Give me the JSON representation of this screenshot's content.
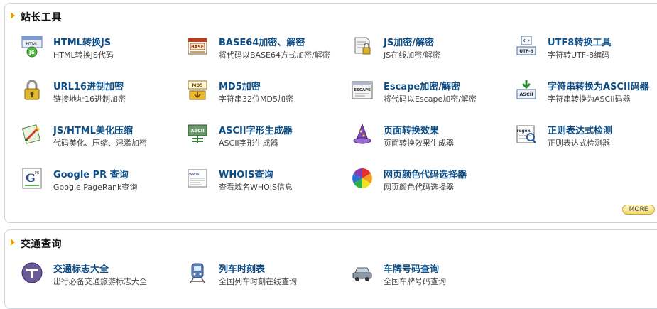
{
  "tools": {
    "header": "站长工具",
    "more_label": "MORE",
    "items": [
      {
        "title": "HTML转换JS",
        "desc": "HTML转换JS代码",
        "icon": "html-js-icon"
      },
      {
        "title": "BASE64加密、解密",
        "desc": "将代码以BASE64方式加密/解密",
        "icon": "base64-icon"
      },
      {
        "title": "JS加密/解密",
        "desc": "JS在线加密/解密",
        "icon": "js-encrypt-icon"
      },
      {
        "title": "UTF8转换工具",
        "desc": "字符转UTF-8编码",
        "icon": "utf8-icon"
      },
      {
        "title": "URL16进制加密",
        "desc": "链接地址16进制加密",
        "icon": "padlock-icon"
      },
      {
        "title": "MD5加密",
        "desc": "字符串32位MD5加密",
        "icon": "md5-icon"
      },
      {
        "title": "Escape加密/解密",
        "desc": "将代码以Escape加密/解密",
        "icon": "escape-icon"
      },
      {
        "title": "字符串转换为ASCII码器",
        "desc": "字符串转换为ASCII码器",
        "icon": "ascii-convert-icon"
      },
      {
        "title": "JS/HTML美化压缩",
        "desc": "代码美化、压缩、混淆加密",
        "icon": "beautify-icon"
      },
      {
        "title": "ASCII字形生成器",
        "desc": "ASCII字形生成器",
        "icon": "ascii-glyph-icon"
      },
      {
        "title": "页面转换效果",
        "desc": "页面转换效果生成器",
        "icon": "wizard-hat-icon"
      },
      {
        "title": "正则表达式检测",
        "desc": "正则表达式检测器",
        "icon": "regex-icon"
      },
      {
        "title": "Google PR 查询",
        "desc": "Google PageRank查询",
        "icon": "google-pr-icon"
      },
      {
        "title": "WHOIS查询",
        "desc": "查看域名WHOIS信息",
        "icon": "whois-icon"
      },
      {
        "title": "网页颜色代码选择器",
        "desc": "网页颜色代码选择器",
        "icon": "color-wheel-icon"
      }
    ]
  },
  "traffic": {
    "header": "交通查询",
    "items": [
      {
        "title": "交通标志大全",
        "desc": "出行必备交通旅游标志大全",
        "icon": "traffic-sign-icon"
      },
      {
        "title": "列车时刻表",
        "desc": "全国列车时刻在线查询",
        "icon": "train-icon"
      },
      {
        "title": "车牌号码查询",
        "desc": "全国车牌号码查询",
        "icon": "car-icon"
      }
    ]
  },
  "icon_text": {
    "html": "HTML",
    "js": "JS",
    "base": "BASE",
    "md5": "MD5",
    "escape": "ESCAPE",
    "ascii": "ASCII",
    "utf8": "UTF-8",
    "regex": "regex",
    "pr": "PR",
    "www": "www."
  },
  "colors": {
    "title": "#0e4e87",
    "header_arrow": "#e0a000",
    "border": "#c9d4df"
  }
}
